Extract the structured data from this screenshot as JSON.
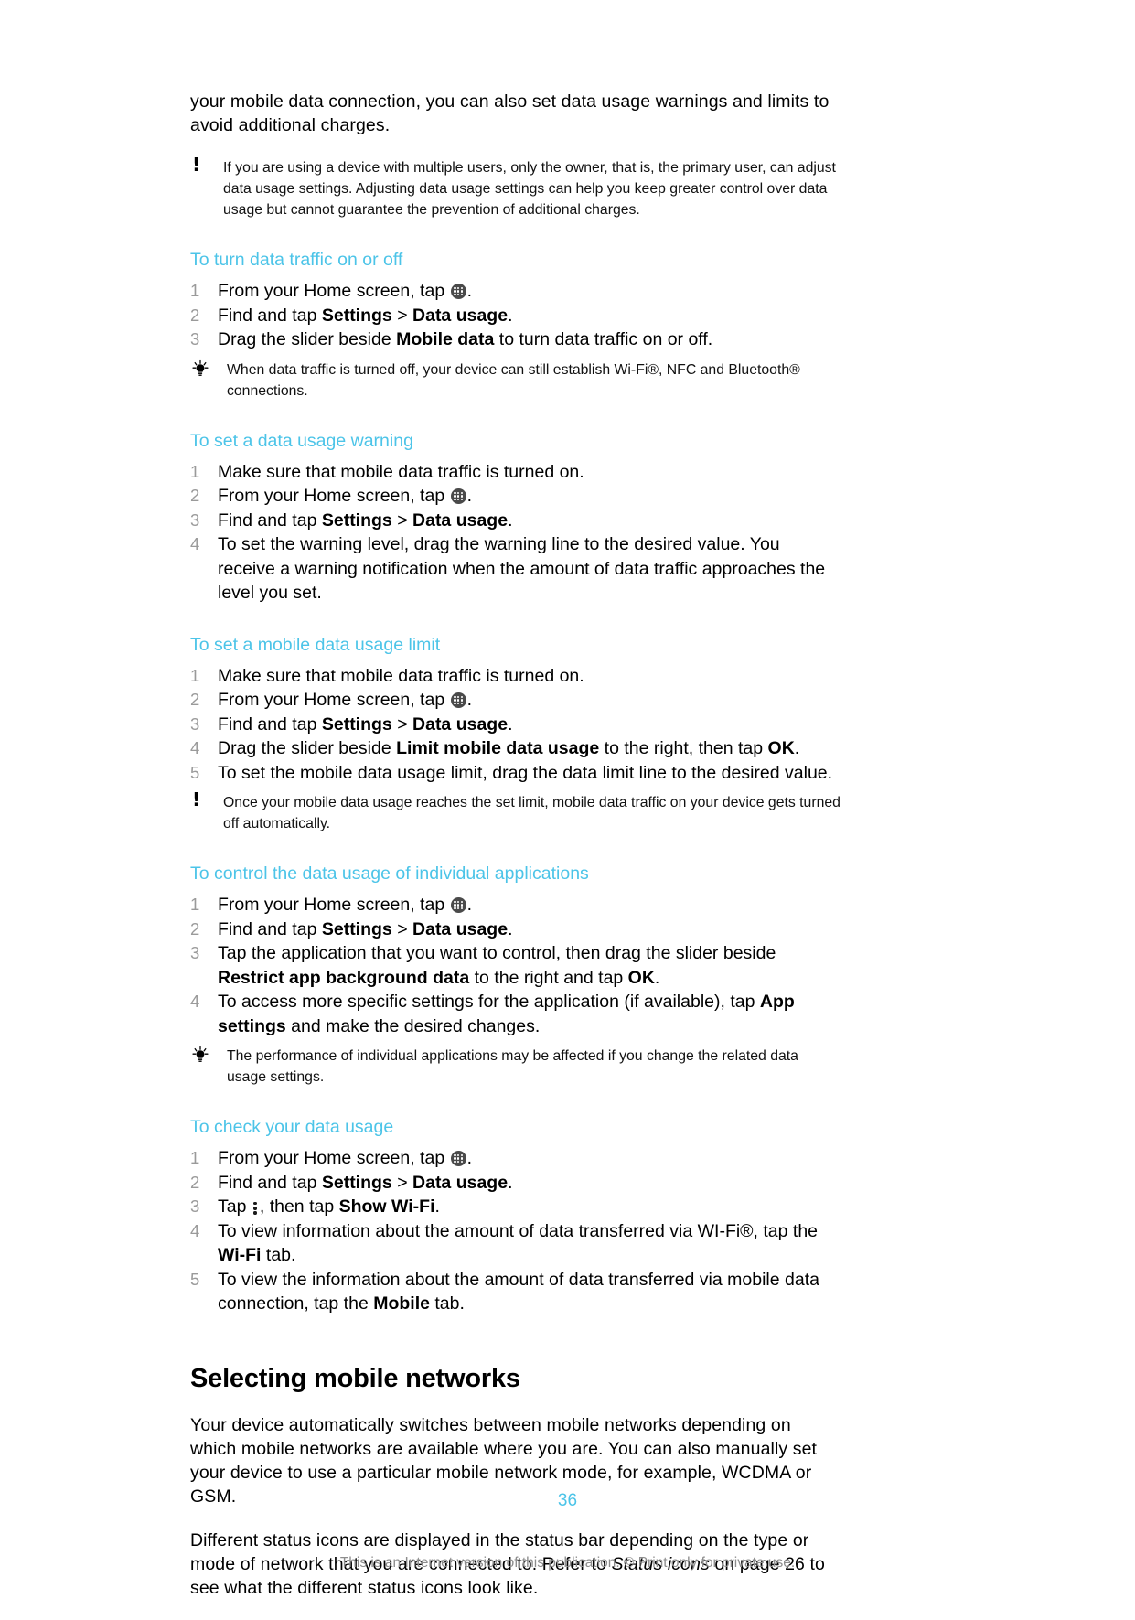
{
  "document": {
    "intro_paragraph": "your mobile data connection, you can also set data usage warnings and limits to avoid additional charges.",
    "note_1": "If you are using a device with multiple users, only the owner, that is, the primary user, can adjust data usage settings. Adjusting data usage settings can help you keep greater control over data usage but cannot guarantee the prevention of additional charges.",
    "note_2": "Once your mobile data usage reaches the set limit, mobile data traffic on your device gets turned off automatically.",
    "tip_1": "When data traffic is turned off, your device can still establish Wi-Fi®, NFC and Bluetooth® connections.",
    "tip_2": "The performance of individual applications may be affected if you change the related data usage settings.",
    "page_number": "36",
    "footer": "This is an Internet version of this publication. © Print only for private use.",
    "accent_color": "#4cc4e8",
    "number_color": "#9a9a9a"
  },
  "sections": [
    {
      "heading": "To turn data traffic on or off",
      "steps": [
        {
          "num": "1",
          "pre": "From your Home screen, tap ",
          "icon": "app-drawer-icon",
          "post": "."
        },
        {
          "num": "2",
          "pre": "Find and tap ",
          "bold1": "Settings",
          "mid": " > ",
          "bold2": "Data usage",
          "post": "."
        },
        {
          "num": "3",
          "pre": "Drag the slider beside ",
          "bold1": "Mobile data",
          "post": " to turn data traffic on or off."
        }
      ]
    },
    {
      "heading": "To set a data usage warning",
      "steps": [
        {
          "num": "1",
          "pre": "Make sure that mobile data traffic is turned on."
        },
        {
          "num": "2",
          "pre": "From your Home screen, tap ",
          "icon": "app-drawer-icon",
          "post": "."
        },
        {
          "num": "3",
          "pre": "Find and tap ",
          "bold1": "Settings",
          "mid": " > ",
          "bold2": "Data usage",
          "post": "."
        },
        {
          "num": "4",
          "pre": "To set the warning level, drag the warning line to the desired value. You receive a warning notification when the amount of data traffic approaches the level you set."
        }
      ]
    },
    {
      "heading": "To set a mobile data usage limit",
      "steps": [
        {
          "num": "1",
          "pre": "Make sure that mobile data traffic is turned on."
        },
        {
          "num": "2",
          "pre": "From your Home screen, tap ",
          "icon": "app-drawer-icon",
          "post": "."
        },
        {
          "num": "3",
          "pre": "Find and tap ",
          "bold1": "Settings",
          "mid": " > ",
          "bold2": "Data usage",
          "post": "."
        },
        {
          "num": "4",
          "pre": "Drag the slider beside ",
          "bold1": "Limit mobile data usage",
          "mid": " to the right, then tap ",
          "bold2": "OK",
          "post": "."
        },
        {
          "num": "5",
          "pre": "To set the mobile data usage limit, drag the data limit line to the desired value."
        }
      ]
    },
    {
      "heading": "To control the data usage of individual applications",
      "steps": [
        {
          "num": "1",
          "pre": "From your Home screen, tap ",
          "icon": "app-drawer-icon",
          "post": "."
        },
        {
          "num": "2",
          "pre": "Find and tap ",
          "bold1": "Settings",
          "mid": " > ",
          "bold2": "Data usage",
          "post": "."
        },
        {
          "num": "3",
          "pre": "Tap the application that you want to control, then drag the slider beside ",
          "bold1": "Restrict app background data",
          "mid": " to the right and tap ",
          "bold2": "OK",
          "post": "."
        },
        {
          "num": "4",
          "pre": "To access more specific settings for the application (if available), tap ",
          "bold1": "App settings",
          "post": " and make the desired changes."
        }
      ]
    },
    {
      "heading": "To check your data usage",
      "steps": [
        {
          "num": "1",
          "pre": "From your Home screen, tap ",
          "icon": "app-drawer-icon",
          "post": "."
        },
        {
          "num": "2",
          "pre": "Find and tap ",
          "bold1": "Settings",
          "mid": " > ",
          "bold2": "Data usage",
          "post": "."
        },
        {
          "num": "3",
          "pre": "Tap ",
          "icon": "overflow-menu-icon",
          "mid": ", then tap ",
          "bold2": "Show Wi-Fi",
          "post": "."
        },
        {
          "num": "4",
          "pre": "To view information about the amount of data transferred via WI-Fi®, tap the ",
          "bold1": "Wi-Fi",
          "post": " tab."
        },
        {
          "num": "5",
          "pre": "To view the information about the amount of data transferred via mobile data connection, tap the ",
          "bold1": "Mobile",
          "post": " tab."
        }
      ]
    }
  ],
  "chapter": {
    "title": "Selecting mobile networks",
    "paragraph_1": "Your device automatically switches between mobile networks depending on which mobile networks are available where you are. You can also manually set your device to use a particular mobile network mode, for example, WCDMA or GSM.",
    "paragraph_2_part1": "Different status icons are displayed in the status bar depending on the type or mode of network that you are connected to. Refer to ",
    "paragraph_2_italic": "Status icons",
    "paragraph_2_part2": " on page 26 to see what the different status icons look like."
  }
}
